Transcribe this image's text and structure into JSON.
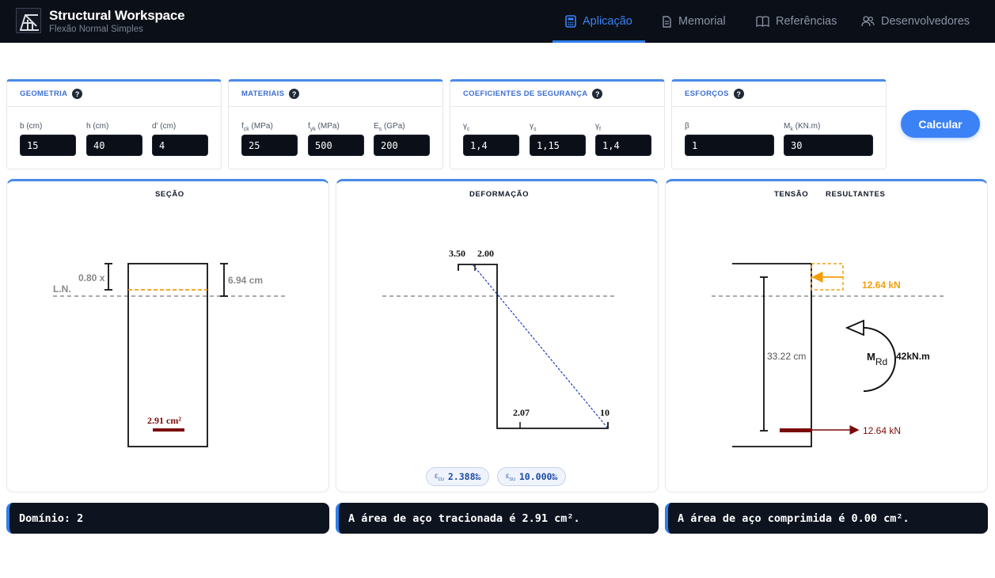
{
  "header": {
    "title": "Structural Workspace",
    "subtitle": "Flexão Normal Simples",
    "nav": [
      {
        "label": "Aplicação",
        "icon": "calculator-icon",
        "active": true
      },
      {
        "label": "Memorial",
        "icon": "document-icon",
        "active": false
      },
      {
        "label": "Referências",
        "icon": "book-icon",
        "active": false
      },
      {
        "label": "Desenvolvedores",
        "icon": "users-icon",
        "active": false
      }
    ]
  },
  "inputs": {
    "geometria": {
      "title": "GEOMETRIA",
      "fields": [
        {
          "label": "b (cm)",
          "value": "15"
        },
        {
          "label": "h (cm)",
          "value": "40"
        },
        {
          "label": "d' (cm)",
          "value": "4"
        }
      ]
    },
    "materiais": {
      "title": "MATERIAIS",
      "fields": [
        {
          "label_main": "f",
          "label_sub": "ck",
          "label_unit": " (MPa)",
          "value": "25"
        },
        {
          "label_main": "f",
          "label_sub": "yk",
          "label_unit": " (MPa)",
          "value": "500"
        },
        {
          "label_main": "E",
          "label_sub": "s",
          "label_unit": " (GPa)",
          "value": "200"
        }
      ]
    },
    "coeficientes": {
      "title": "COEFICIENTES DE SEGURANÇA",
      "fields": [
        {
          "label_main": "γ",
          "label_sub": "c",
          "value": "1,4"
        },
        {
          "label_main": "γ",
          "label_sub": "s",
          "value": "1,15"
        },
        {
          "label_main": "γ",
          "label_sub": "f",
          "value": "1,4"
        }
      ]
    },
    "esforcos": {
      "title": "ESFORÇOS",
      "fields": [
        {
          "label": "β",
          "value": "1"
        },
        {
          "label_main": "M",
          "label_sub": "k",
          "label_unit": " (KN.m)",
          "value": "30"
        }
      ]
    },
    "calc_button": "Calcular"
  },
  "panels": {
    "secao": {
      "title": "SEÇÃO",
      "ln_label": "L.N.",
      "x_label": "0.80 x",
      "depth_label": "6.94 cm",
      "steel_label": "2.91 cm²"
    },
    "deformacao": {
      "title": "DEFORMAÇÃO",
      "top_left": "3.50",
      "top_right": "2.00",
      "bottom_left": "2.07",
      "bottom_right": "10",
      "eps_cu_label": "ε",
      "eps_cu_sub": "cu",
      "eps_cu_value": "2.388‰",
      "eps_su_label": "ε",
      "eps_su_sub": "su",
      "eps_su_value": "10.000‰"
    },
    "tensao": {
      "title_left": "TENSÃO",
      "title_right": "RESULTANTES",
      "force_top": "12.64 kN",
      "force_bottom": "12.64 kN",
      "lever_arm": "33.22 cm",
      "moment_main": "M",
      "moment_sub": "Rd",
      "moment_value": "42kN.m"
    }
  },
  "results": {
    "dominio": "Domínio: 2",
    "tracionada": "A área de aço tracionada é 2.91 cm².",
    "comprimida": "A área de aço comprimida é 0.00 cm²."
  },
  "colors": {
    "accent": "#3b82f6",
    "dark": "#0b0f17",
    "steel": "#7a0a0a",
    "compression": "#f59e0b",
    "strain_line": "#1e3fbf"
  }
}
